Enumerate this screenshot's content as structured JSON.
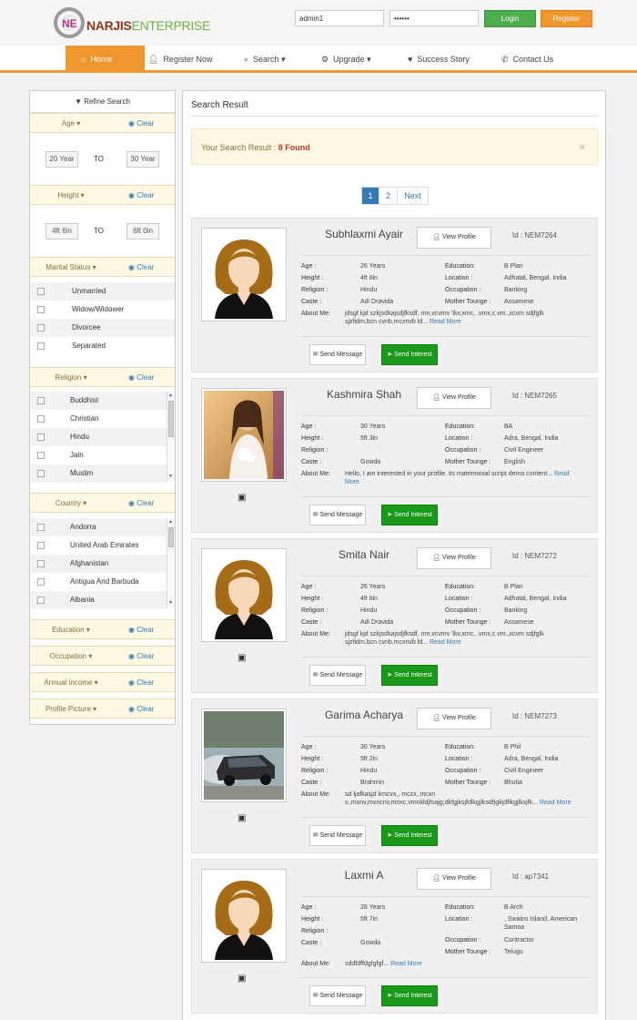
{
  "brand": {
    "name_part1": "NARJIS",
    "name_part2": "ENTERPRISE"
  },
  "login": {
    "username_value": "admin1",
    "password_value": "••••••",
    "login_label": "Login",
    "register_label": "Register"
  },
  "nav": {
    "items": [
      {
        "label": "Home",
        "icon": "home-icon"
      },
      {
        "label": "Register Now",
        "icon": "user-icon"
      },
      {
        "label": "Search",
        "icon": "search-icon"
      },
      {
        "label": "Upgrade",
        "icon": "gear-icon"
      },
      {
        "label": "Success Story",
        "icon": "heart-icon"
      },
      {
        "label": "Contact Us",
        "icon": "phone-icon"
      }
    ],
    "caret": "▾"
  },
  "sidebar": {
    "title": "Refine Search",
    "clear_label": "Clear",
    "age": {
      "label": "Age",
      "from": "20 Year",
      "to_label": "TO",
      "to": "30 Year"
    },
    "height": {
      "label": "Height",
      "from": "4ft 6in",
      "to_label": "TO",
      "to": "6ft 0in"
    },
    "marital_status": {
      "label": "Marital Status",
      "options": [
        "Unmarried",
        "Widow/Widower",
        "Divorcee",
        "Separated"
      ]
    },
    "religion": {
      "label": "Religion",
      "options": [
        "Buddhist",
        "Christian",
        "Hindu",
        "Jain",
        "Muslim"
      ]
    },
    "country": {
      "label": "Country",
      "options": [
        "Andorra",
        "United Arab Emirates",
        "Afghanistan",
        "Antigua And Barbuda",
        "Albania"
      ]
    },
    "education": {
      "label": "Education"
    },
    "occupation": {
      "label": "Occupation"
    },
    "annual_income": {
      "label": "Annual income"
    },
    "profile_picture": {
      "label": "Profile Picture"
    }
  },
  "results": {
    "title": "Search Result",
    "summary_label": "Your Search Result : ",
    "summary_count": "8 Found",
    "close_glyph": "×",
    "pagination": [
      "1",
      "2",
      "Next"
    ],
    "field_labels": {
      "age": "Age :",
      "height": "Height :",
      "religion": "Religion :",
      "caste": "Caste :",
      "about": "About Me:",
      "education": "Education:",
      "location": "Location :",
      "occupation": "Occupation :",
      "mother_tongue": "Mother Tounge :"
    },
    "view_profile_label": "View Profile",
    "send_message_label": "Send Message",
    "send_interest_label": "Send Interest",
    "read_more_label": "Read More",
    "profiles": [
      {
        "name": "Subhlaxmi Ayair",
        "id": "Id : NEM7264",
        "age": "26 Years",
        "height": "4ft 8in",
        "religion": "Hindu",
        "caste": "Adi Dravida",
        "about_line1": "jdsgf kjd szkjsdkajsdjfksdf, mn,vcvmv 'lkv,xmc, .vmx,c.vm.,xcvm sdjfglk",
        "about_line2": "sjzfidm,bcn cvnb,mcxnvb ld...",
        "education": "B Plan",
        "location": "Adhatal, Bengal, India",
        "occupation": "Banking",
        "mother_tongue": "Assamese",
        "photo": "avatar"
      },
      {
        "name": "Kashmira Shah",
        "id": "Id : NEM7265",
        "age": "30 Years",
        "height": "5ft 3in",
        "religion": "",
        "caste": "Gowda",
        "about_line1": "Hello, I am interested in your profile. its matrimonial script demo content...",
        "about_line2": "More",
        "education": "BA",
        "location": "Adra, Bengal, India",
        "occupation": "Civil Engineer",
        "mother_tongue": "English",
        "photo": "photo-woman"
      },
      {
        "name": "Smita Nair",
        "id": "Id : NEM7272",
        "age": "26 Years",
        "height": "4ft 8in",
        "religion": "Hindu",
        "caste": "Adi Dravida",
        "about_line1": "jdsgf kjd szkjsdkajsdjfksdf, mn,vcvmv 'lkv,xmc, .vmx,c.vm.,xcvm sdjfglk",
        "about_line2": "sjzfidm,bcn cvnb,mcxnvb ld...",
        "education": "B Plan",
        "location": "Adhatal, Bengal, India",
        "occupation": "Banking",
        "mother_tongue": "Assamese",
        "photo": "avatar"
      },
      {
        "name": "Garima Acharya",
        "id": "Id : NEM7273",
        "age": "30 Years",
        "height": "5ft 2in",
        "religion": "Hindu",
        "caste": "Brahmin",
        "about_line1": "sd ljafkasjd kmcvx,, mczx,,mcxn",
        "about_line2": "v.,mxnv,mxncnv,mnxc,vmnkldjfsajg;dkfgjksjfdlkgjlksdfjgkjdflkgjlksjfk...",
        "education": "B Phil",
        "location": "Adra, Bengal, India",
        "occupation": "Civil Engineer",
        "mother_tongue": "Bhutia",
        "photo": "photo-car"
      },
      {
        "name": "Laxmi A",
        "id": "Id : ap7341",
        "age": "28 Years",
        "height": "5ft 7in",
        "religion": "",
        "caste": "Gowda",
        "about_line1": "sddfdffdgfgfgf...",
        "about_line2": "",
        "education": "B Arch",
        "location_line1": ", Swains Island, American",
        "location_line2": "Samoa",
        "occupation": "Contractor",
        "mother_tongue": "Telugu",
        "photo": "avatar"
      }
    ]
  },
  "colors": {
    "accent_orange": "#f0962e",
    "login_green": "#4cae4c",
    "interest_green": "#1a9a1a",
    "link_blue": "#337ab7",
    "alert_bg": "#fcf8e3"
  }
}
